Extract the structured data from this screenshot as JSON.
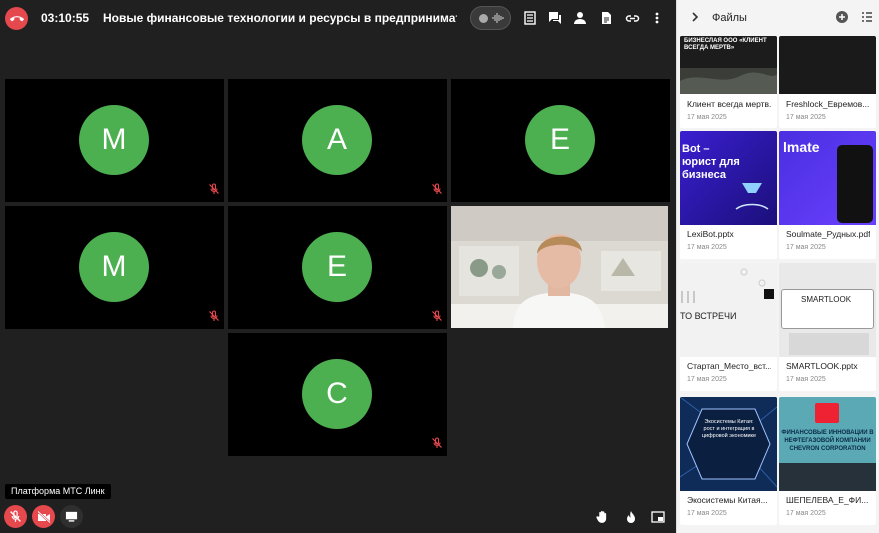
{
  "call": {
    "timer": "03:10:55",
    "title": "Новые финансовые технологии и ресурсы в предпринимательстве",
    "platform_label": "Платформа МТС Линк",
    "participants": [
      {
        "initial": "М"
      },
      {
        "initial": "А"
      },
      {
        "initial": "Е"
      },
      {
        "initial": "М"
      },
      {
        "initial": "Е"
      },
      {
        "initial": "С"
      }
    ]
  },
  "files": {
    "title": "Файлы",
    "items": [
      {
        "name": "Клиент всегда мертв...",
        "date": "17 мая 2025",
        "thumb_title": "БИЗНЕСЛАЯ ООО «КЛИЕНТ ВСЕГДА МЕРТВ»"
      },
      {
        "name": "Freshlock_Евремов...",
        "date": "17 мая 2025"
      },
      {
        "name": "LexiBot.pptx",
        "date": "17 мая 2025",
        "thumb_title": "Bot – юрист для бизнеса"
      },
      {
        "name": "Soulmate_Рудных.pdf",
        "date": "17 мая 2025",
        "thumb_title": "lmate"
      },
      {
        "name": "Стартап_Место_вст...",
        "date": "17 мая 2025",
        "thumb_title": "ТО ВСТРЕЧИ"
      },
      {
        "name": "SMARTLOOK.pptx",
        "date": "17 мая 2025",
        "thumb_title": "SMARTLOOK"
      },
      {
        "name": "Экосистемы Китая...",
        "date": "17 мая 2025",
        "thumb_title": "Экосистемы Китая: рост и интеграция в цифровой экономике"
      },
      {
        "name": "ШЕПЕЛЕВА_Е_ФИ...",
        "date": "17 мая 2025",
        "thumb_title": "ФИНАНСОВЫЕ ИННОВАЦИИ В НЕФТЕГАЗОВОЙ КОМПАНИИ CHEVRON CORPORATION"
      }
    ]
  },
  "colors": {
    "accent_green": "#4caf50",
    "danger_red": "#e5484d"
  }
}
